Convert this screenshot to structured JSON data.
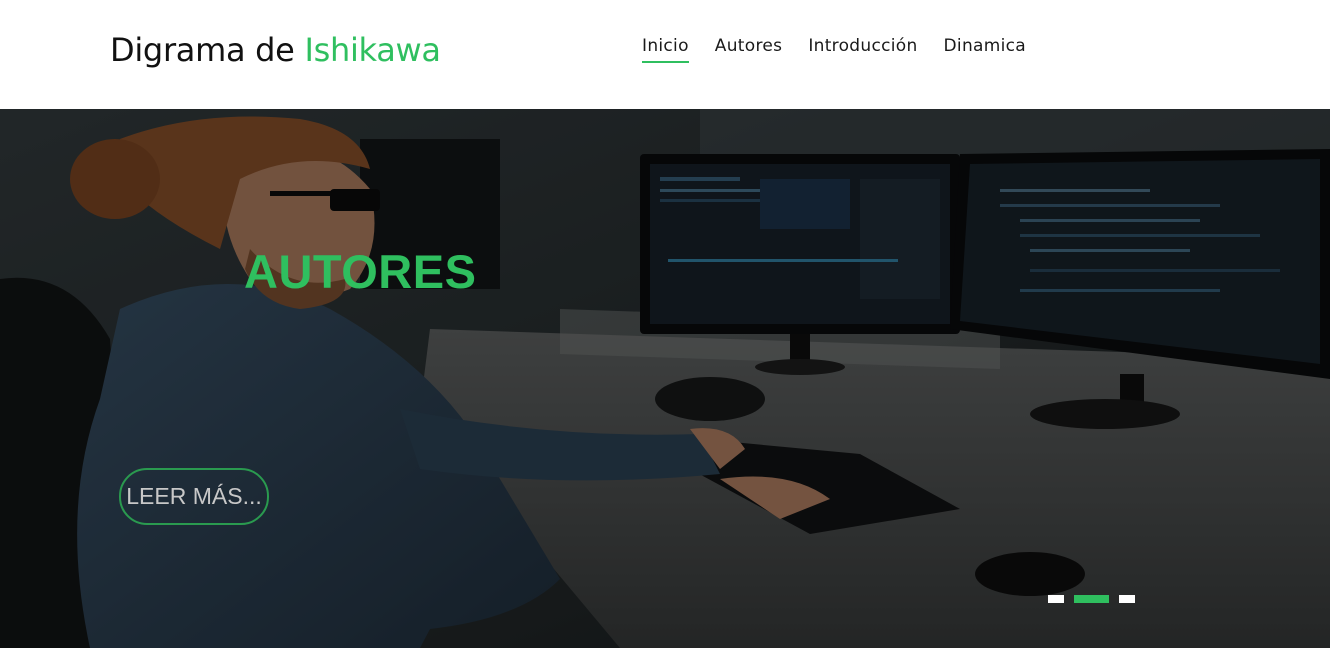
{
  "header": {
    "brand_main": "Digrama de",
    "brand_accent": "Ishikawa",
    "nav": [
      {
        "label": "Inicio",
        "active": true
      },
      {
        "label": "Autores",
        "active": false
      },
      {
        "label": "Introducción",
        "active": false
      },
      {
        "label": "Dinamica",
        "active": false
      }
    ]
  },
  "hero": {
    "title": "AUTORES",
    "button_label": "LEER MÁS...",
    "slides_total": 3,
    "active_slide": 2
  },
  "colors": {
    "accent": "#2fbf5f",
    "text": "#111111",
    "hero_bg": "#1e2325"
  }
}
